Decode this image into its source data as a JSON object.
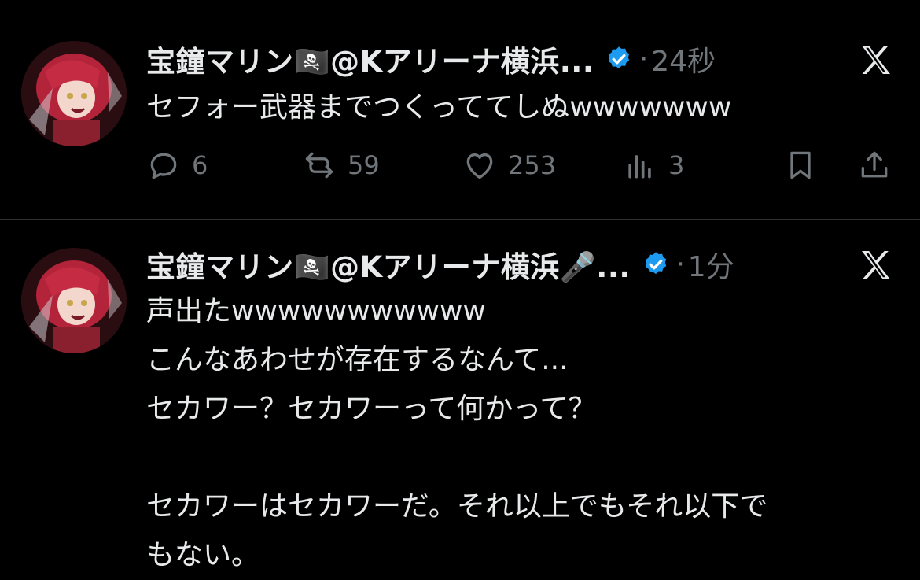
{
  "tweets": [
    {
      "display_name": "宝鐘マリン🏴‍☠️@Kアリーナ横浜...",
      "time": "24秒",
      "text": "セフォー武器までつくっててしぬwwwwwww",
      "reply_count": "6",
      "retweet_count": "59",
      "like_count": "253",
      "view_count": "3"
    },
    {
      "display_name": "宝鐘マリン🏴‍☠️@Kアリーナ横浜🎤...",
      "time": "1分",
      "text": "声出たwwwwwwwwwww\nこんなあわせが存在するなんて...\nセカワー？セカワーって何かって？\n\nセカワーはセカワーだ。それ以上でもそれ以下で\nもない。"
    }
  ],
  "colors": {
    "background": "#000000",
    "text": "#e7e9ea",
    "secondary": "#71767b",
    "verified": "#1d9bf0",
    "divider": "#2f3336"
  }
}
